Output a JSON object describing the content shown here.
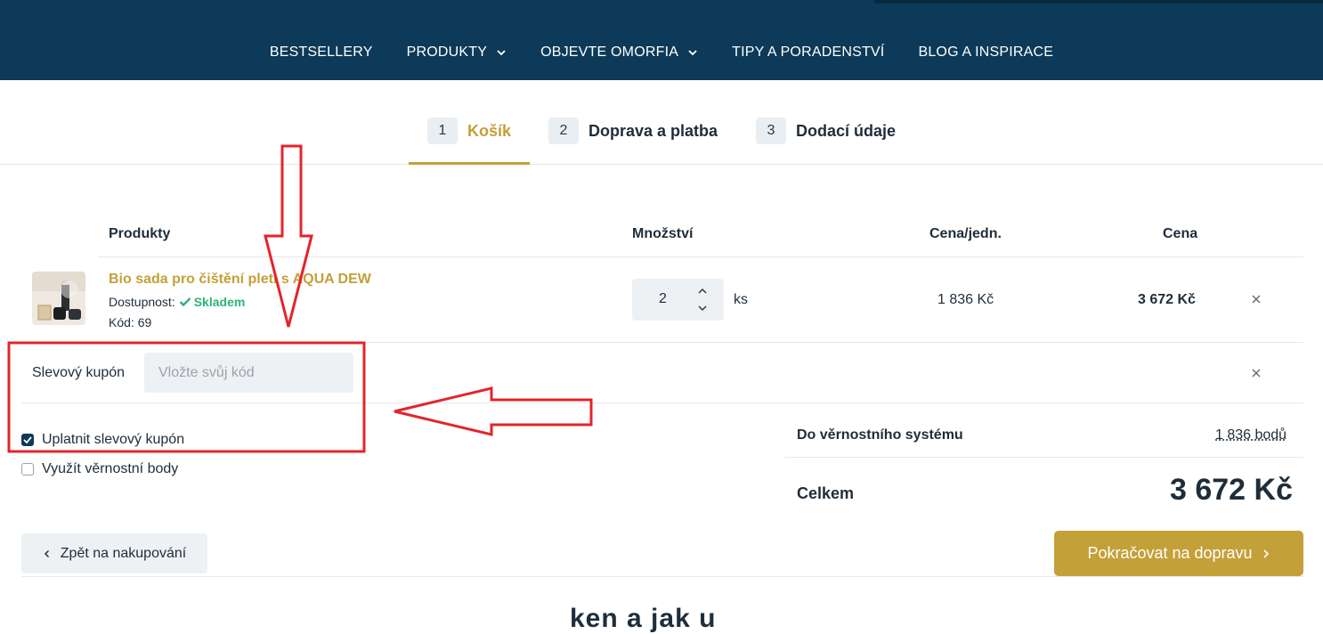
{
  "nav": {
    "items": [
      {
        "label": "BESTSELLERY",
        "dropdown": false
      },
      {
        "label": "PRODUKTY",
        "dropdown": true
      },
      {
        "label": "OBJEVTE OMORFIA",
        "dropdown": true
      },
      {
        "label": "TIPY A PORADENSTVÍ",
        "dropdown": false
      },
      {
        "label": "BLOG A INSPIRACE",
        "dropdown": false
      }
    ]
  },
  "steps": [
    {
      "num": "1",
      "label": "Košík",
      "active": true
    },
    {
      "num": "2",
      "label": "Doprava a platba",
      "active": false
    },
    {
      "num": "3",
      "label": "Dodací údaje",
      "active": false
    }
  ],
  "table": {
    "headers": {
      "product": "Produkty",
      "qty": "Množství",
      "unit_price": "Cena/jedn.",
      "price": "Cena"
    },
    "item": {
      "name": "Bio sada pro čištění pleti s AQUA DEW",
      "availability_label": "Dostupnost:",
      "availability_value": "Skladem",
      "code": "Kód: 69",
      "quantity": "2",
      "unit": "ks",
      "unit_price": "1 836 Kč",
      "total_price": "3 672 Kč"
    }
  },
  "coupon": {
    "label": "Slevový kupón",
    "placeholder": "Vložte svůj kód",
    "apply_label": "Uplatnit slevový kupón",
    "apply_checked": true,
    "loyalty_label": "Využít věrnostní body",
    "loyalty_checked": false
  },
  "summary": {
    "loyalty_label": "Do věrnostního systému",
    "loyalty_value": "1 836 bodů",
    "total_label": "Celkem",
    "total_value": "3 672 Kč"
  },
  "actions": {
    "back_label": "Zpět na nakupování",
    "next_label": "Pokračovat na dopravu"
  },
  "bottom_heading": "ken a jak u",
  "colors": {
    "header_bg": "#0c3a58",
    "accent_gold": "#c4a039",
    "stock_green": "#2db37a",
    "annotation_red": "#e3242b"
  }
}
